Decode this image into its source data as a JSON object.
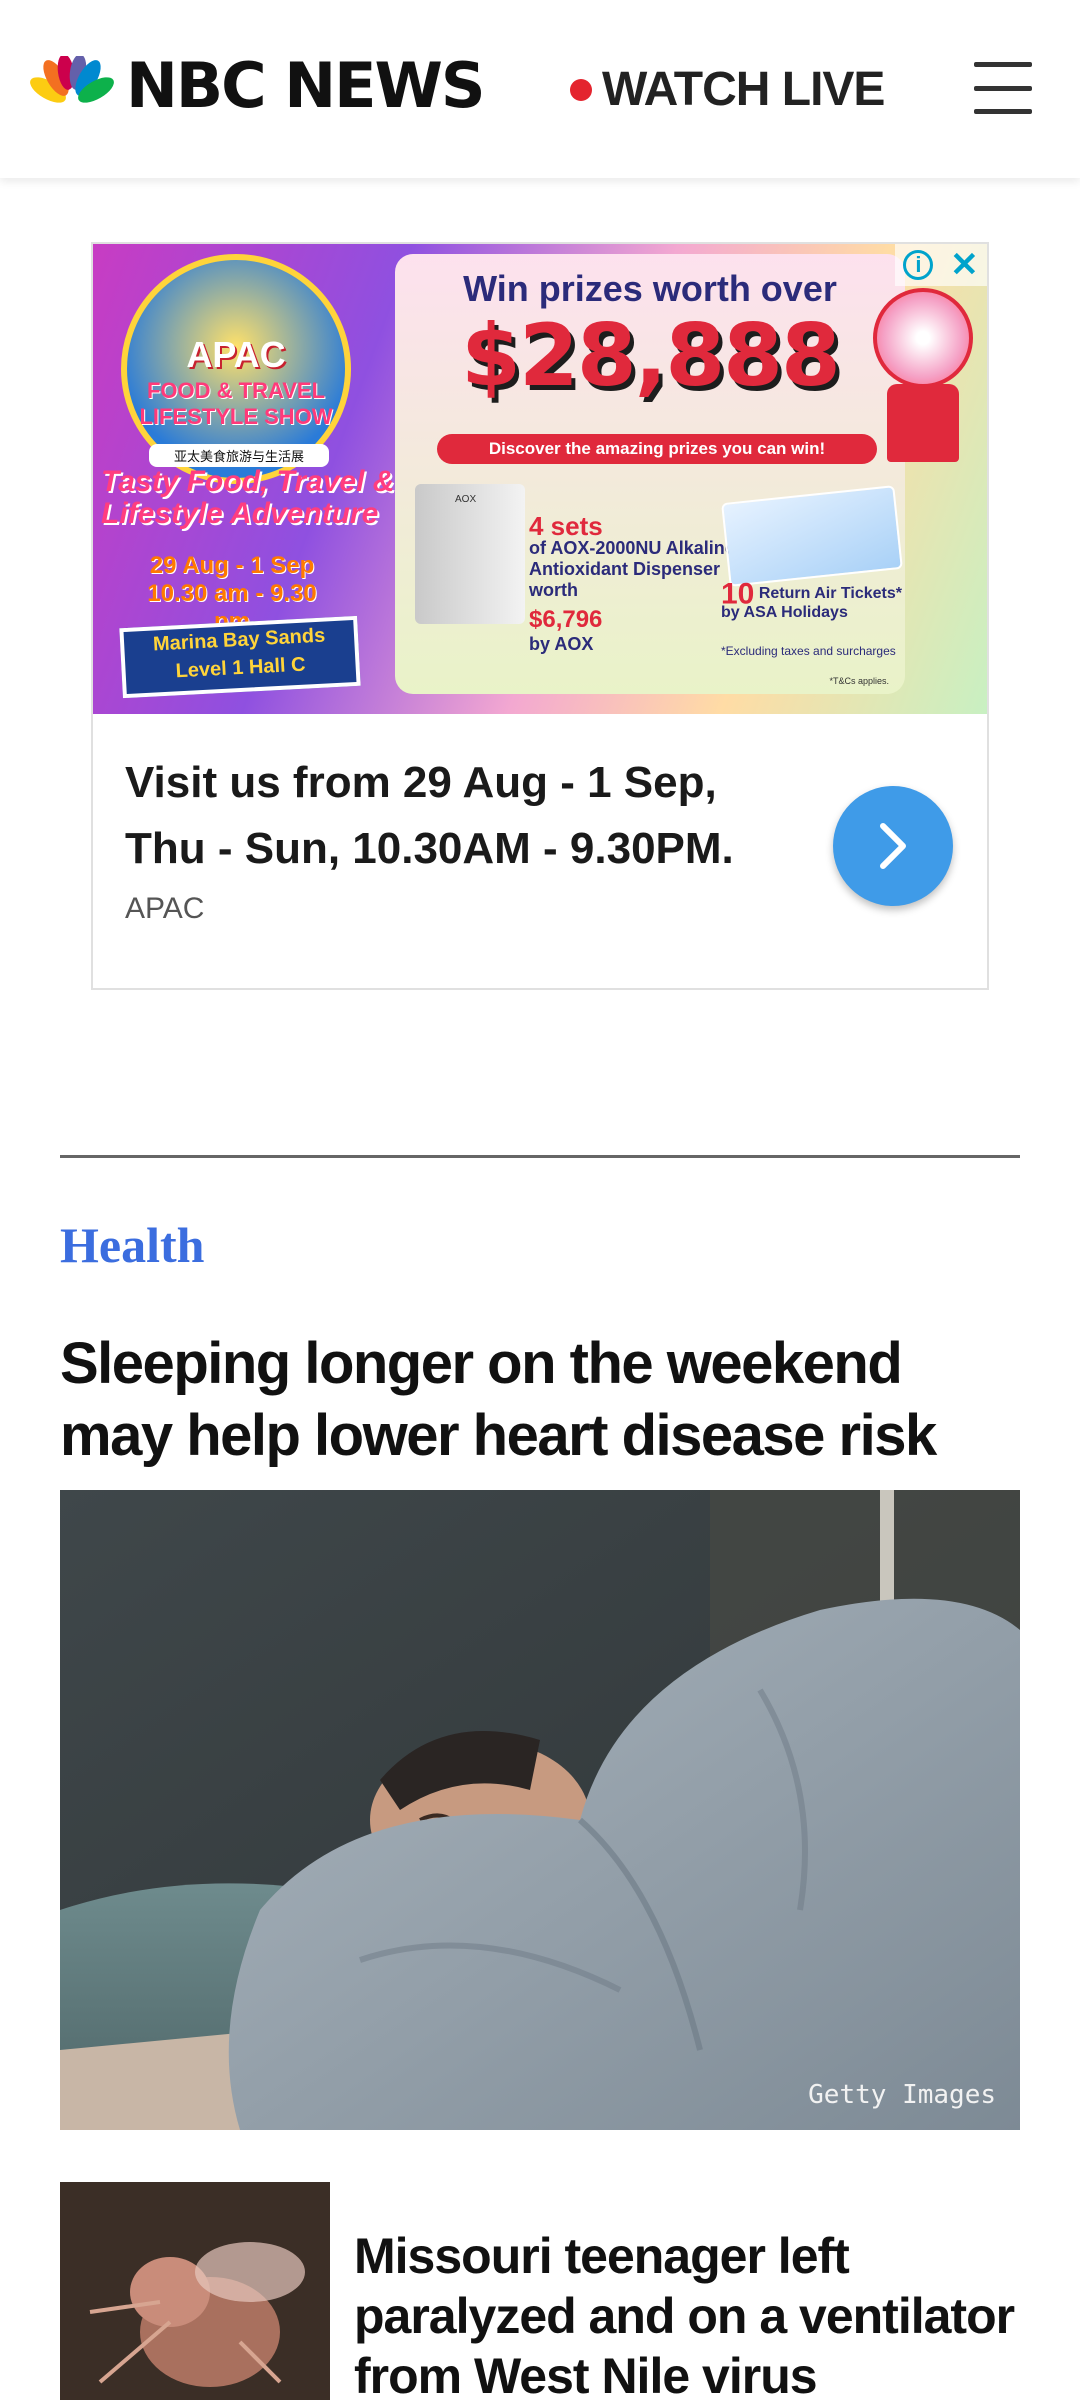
{
  "header": {
    "brand": "NBC NEWS",
    "watch_live": "WATCH LIVE",
    "menu_icon": "hamburger-menu-icon"
  },
  "ad": {
    "apac_title": "APAC",
    "apac_subtitle": "FOOD & TRAVEL LIFESTYLE SHOW",
    "apac_chinese": "亚太美食旅游与生活展",
    "tagline": "Tasty Food, Travel & Lifestyle Adventure",
    "dates": "29 Aug - 1 Sep",
    "hours": "10.30 am - 9.30 pm",
    "venue_line1": "Marina Bay Sands",
    "venue_line2": "Level 1 Hall C",
    "win_text": "Win prizes worth over",
    "amount": "$28,888",
    "discover": "Discover the amazing prizes you can win!",
    "sets_count": "4 sets",
    "sets_desc": "of AOX-2000NU Alkaline Antioxidant Dispenser worth",
    "sets_price": "$6,796",
    "sets_by": "by AOX",
    "dispenser_brand": "AOX",
    "tickets_count": "10",
    "tickets_text": "Return Air Tickets* by ASA Holidays",
    "tickets_note": "*Excluding taxes and surcharges",
    "tcs": "*T&Cs applies.",
    "headline": "Visit us from 29 Aug - 1 Sep, Thu - Sun, 10.30AM - 9.30PM.",
    "source": "APAC",
    "badge_info": "i",
    "badge_close": "✕"
  },
  "article": {
    "section": "Health",
    "headline": "Sleeping longer on the weekend may help lower heart disease risk",
    "image_credit": "Getty Images"
  },
  "story2": {
    "headline": "Missouri teenager left paralyzed and on a ventilator from West Nile virus"
  }
}
